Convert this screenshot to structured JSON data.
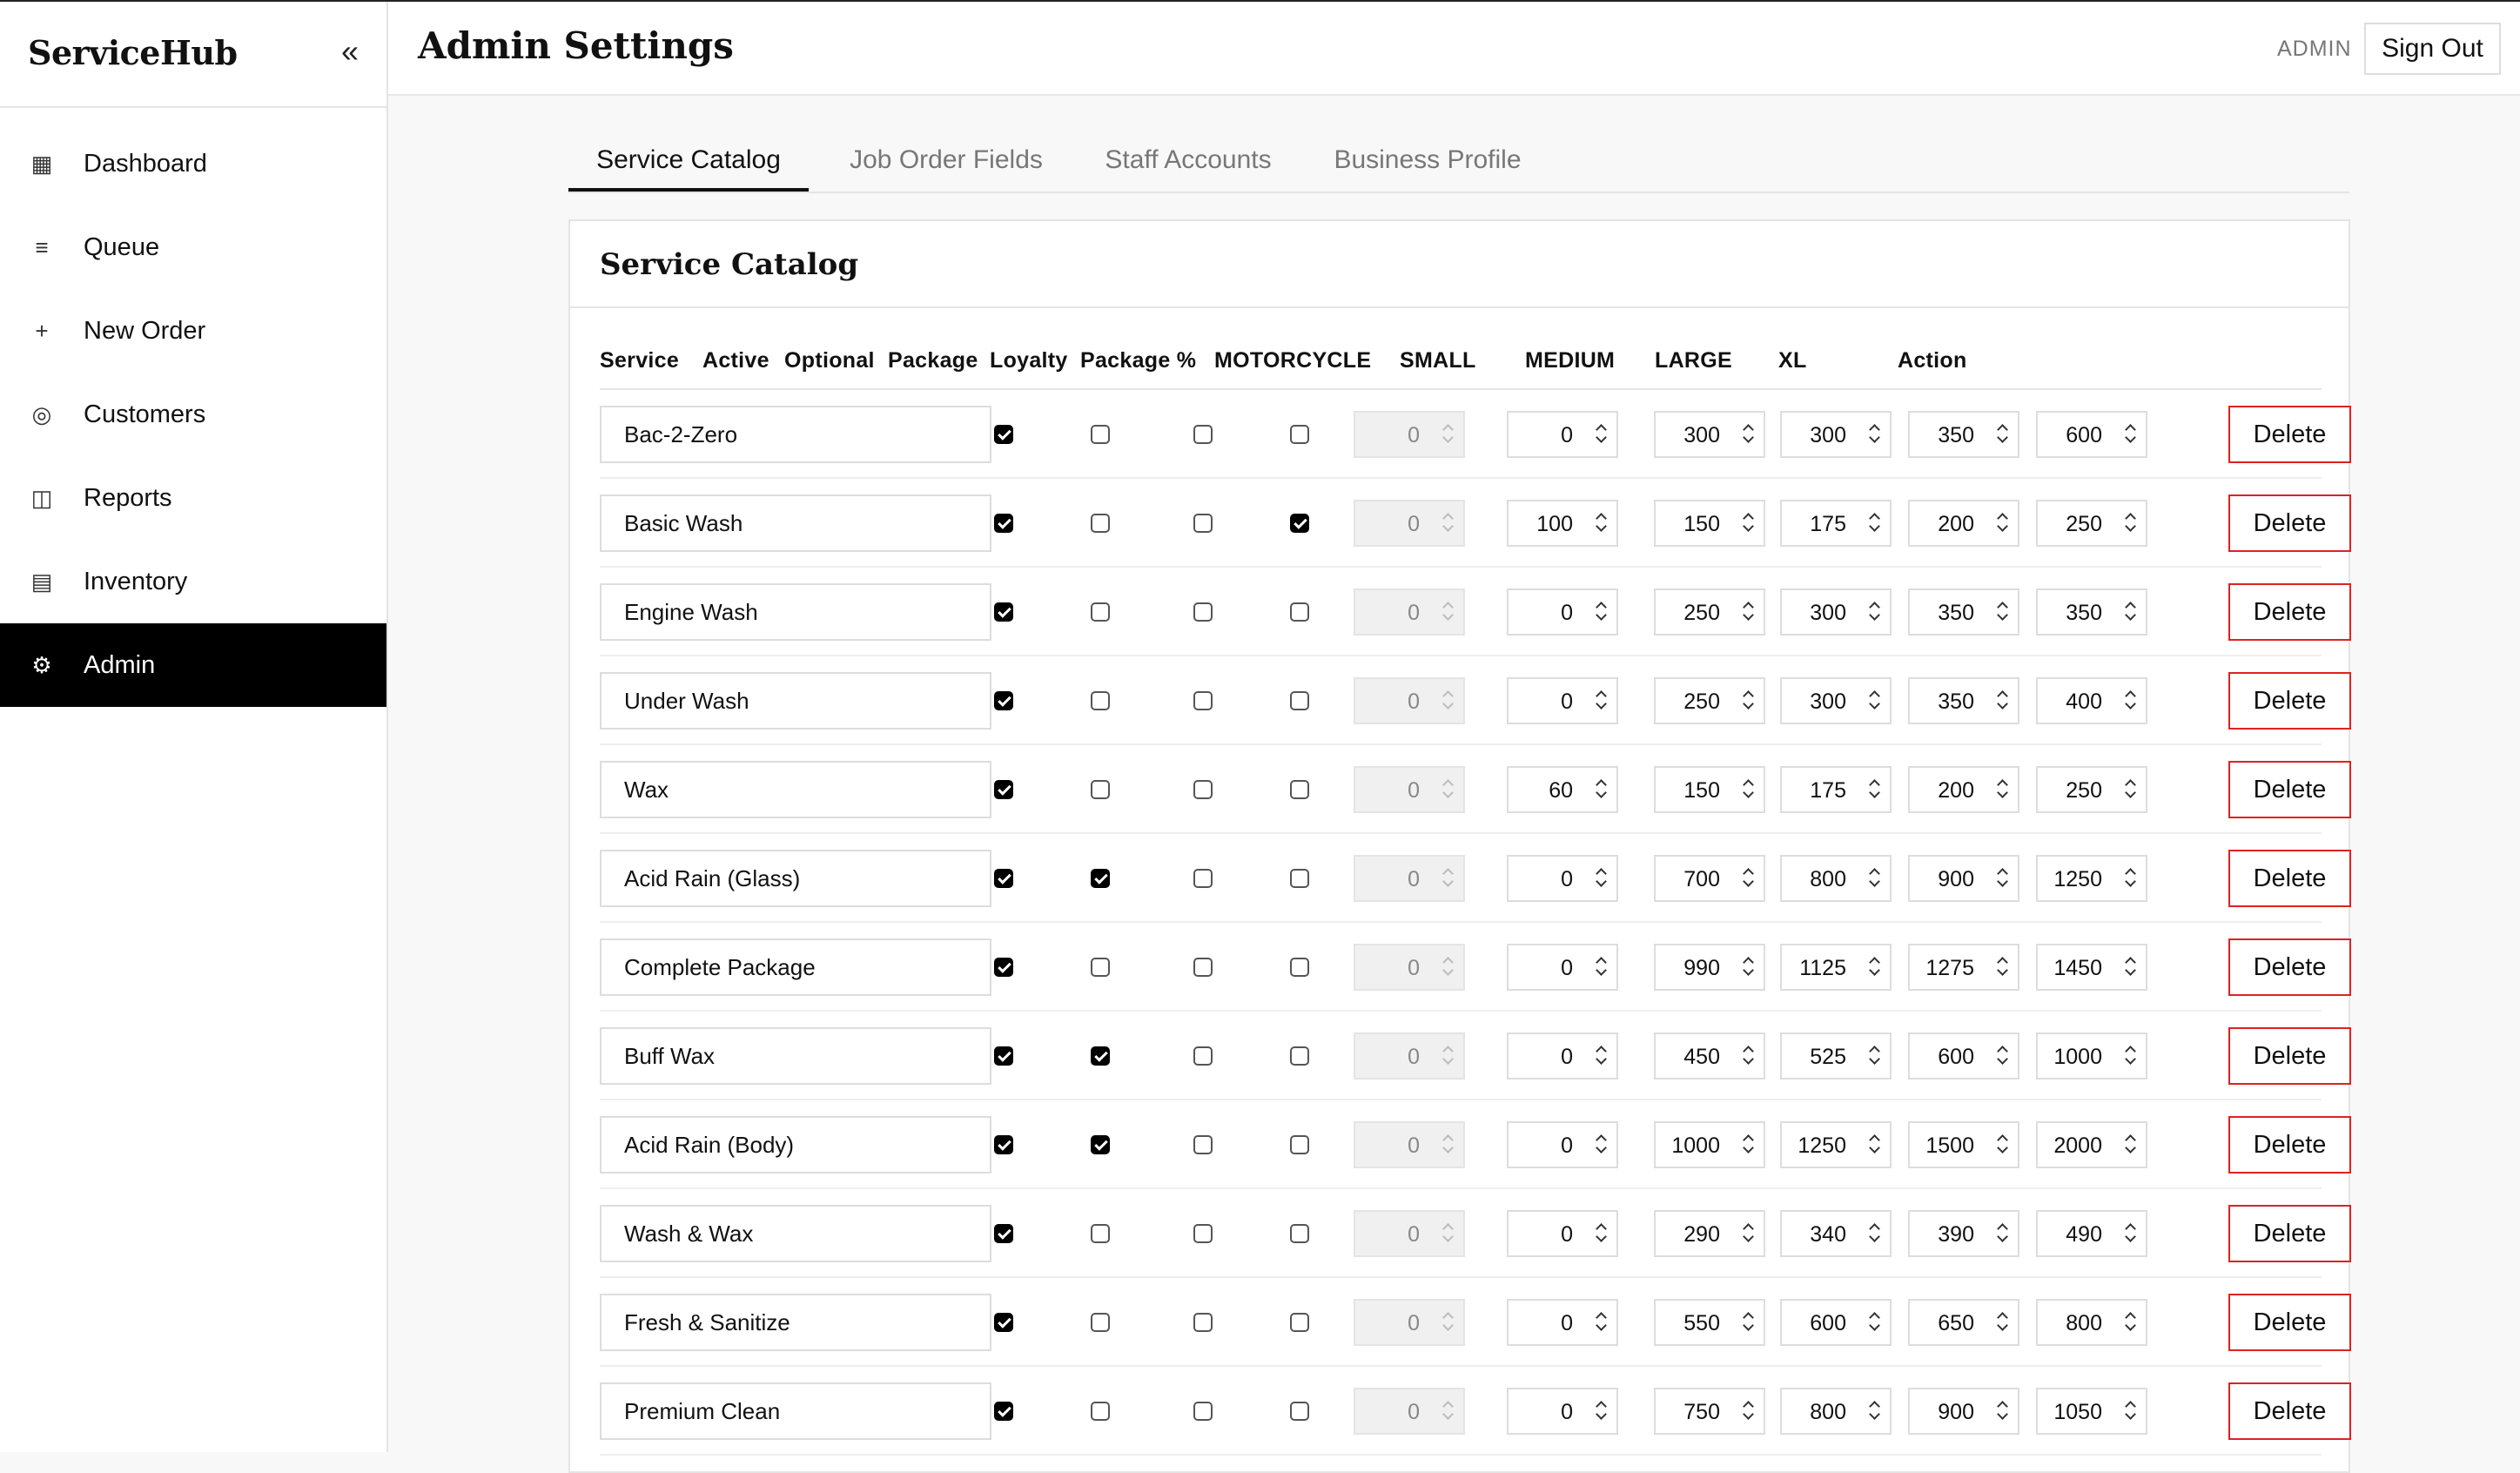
{
  "app": {
    "brand": "ServiceHub",
    "collapse_glyph": "«"
  },
  "sidebar": {
    "items": [
      {
        "label": "Dashboard",
        "icon": "dashboard-icon",
        "glyph": "▦"
      },
      {
        "label": "Queue",
        "icon": "queue-icon",
        "glyph": "≡"
      },
      {
        "label": "New Order",
        "icon": "plus-icon",
        "glyph": "+"
      },
      {
        "label": "Customers",
        "icon": "customers-icon",
        "glyph": "◎"
      },
      {
        "label": "Reports",
        "icon": "reports-icon",
        "glyph": "◫"
      },
      {
        "label": "Inventory",
        "icon": "inventory-icon",
        "glyph": "▤"
      },
      {
        "label": "Admin",
        "icon": "gear-icon",
        "glyph": "⚙",
        "active": true
      }
    ]
  },
  "header": {
    "title": "Admin Settings",
    "role": "ADMIN",
    "signout_label": "Sign Out"
  },
  "tabs": [
    {
      "label": "Service Catalog",
      "active": true
    },
    {
      "label": "Job Order Fields"
    },
    {
      "label": "Staff Accounts"
    },
    {
      "label": "Business Profile"
    }
  ],
  "catalog": {
    "title": "Service Catalog",
    "columns": [
      "Service",
      "Active",
      "Optional",
      "Package",
      "Loyalty",
      "Package %",
      "MOTORCYCLE",
      "SMALL",
      "MEDIUM",
      "LARGE",
      "XL",
      "Action"
    ],
    "delete_label": "Delete",
    "rows": [
      {
        "name": "Bac-2-Zero",
        "active": true,
        "optional": false,
        "package": false,
        "loyalty": false,
        "package_pct": "0",
        "motorcycle": "0",
        "small": "300",
        "medium": "300",
        "large": "350",
        "xl": "600"
      },
      {
        "name": "Basic Wash",
        "active": true,
        "optional": false,
        "package": false,
        "loyalty": true,
        "package_pct": "0",
        "motorcycle": "100",
        "small": "150",
        "medium": "175",
        "large": "200",
        "xl": "250"
      },
      {
        "name": "Engine Wash",
        "active": true,
        "optional": false,
        "package": false,
        "loyalty": false,
        "package_pct": "0",
        "motorcycle": "0",
        "small": "250",
        "medium": "300",
        "large": "350",
        "xl": "350"
      },
      {
        "name": "Under Wash",
        "active": true,
        "optional": false,
        "package": false,
        "loyalty": false,
        "package_pct": "0",
        "motorcycle": "0",
        "small": "250",
        "medium": "300",
        "large": "350",
        "xl": "400"
      },
      {
        "name": "Wax",
        "active": true,
        "optional": false,
        "package": false,
        "loyalty": false,
        "package_pct": "0",
        "motorcycle": "60",
        "small": "150",
        "medium": "175",
        "large": "200",
        "xl": "250"
      },
      {
        "name": "Acid Rain (Glass)",
        "active": true,
        "optional": true,
        "package": false,
        "loyalty": false,
        "package_pct": "0",
        "motorcycle": "0",
        "small": "700",
        "medium": "800",
        "large": "900",
        "xl": "1250"
      },
      {
        "name": "Complete Package",
        "active": true,
        "optional": false,
        "package": false,
        "loyalty": false,
        "package_pct": "0",
        "motorcycle": "0",
        "small": "990",
        "medium": "1125",
        "large": "1275",
        "xl": "1450"
      },
      {
        "name": "Buff Wax",
        "active": true,
        "optional": true,
        "package": false,
        "loyalty": false,
        "package_pct": "0",
        "motorcycle": "0",
        "small": "450",
        "medium": "525",
        "large": "600",
        "xl": "1000"
      },
      {
        "name": "Acid Rain (Body)",
        "active": true,
        "optional": true,
        "package": false,
        "loyalty": false,
        "package_pct": "0",
        "motorcycle": "0",
        "small": "1000",
        "medium": "1250",
        "large": "1500",
        "xl": "2000"
      },
      {
        "name": "Wash & Wax",
        "active": true,
        "optional": false,
        "package": false,
        "loyalty": false,
        "package_pct": "0",
        "motorcycle": "0",
        "small": "290",
        "medium": "340",
        "large": "390",
        "xl": "490"
      },
      {
        "name": "Fresh & Sanitize",
        "active": true,
        "optional": false,
        "package": false,
        "loyalty": false,
        "package_pct": "0",
        "motorcycle": "0",
        "small": "550",
        "medium": "600",
        "large": "650",
        "xl": "800"
      },
      {
        "name": "Premium Clean",
        "active": true,
        "optional": false,
        "package": false,
        "loyalty": false,
        "package_pct": "0",
        "motorcycle": "0",
        "small": "750",
        "medium": "800",
        "large": "900",
        "xl": "1050"
      }
    ]
  },
  "colors": {
    "accent": "#000000",
    "danger": "#dd2222",
    "muted": "#777777"
  }
}
